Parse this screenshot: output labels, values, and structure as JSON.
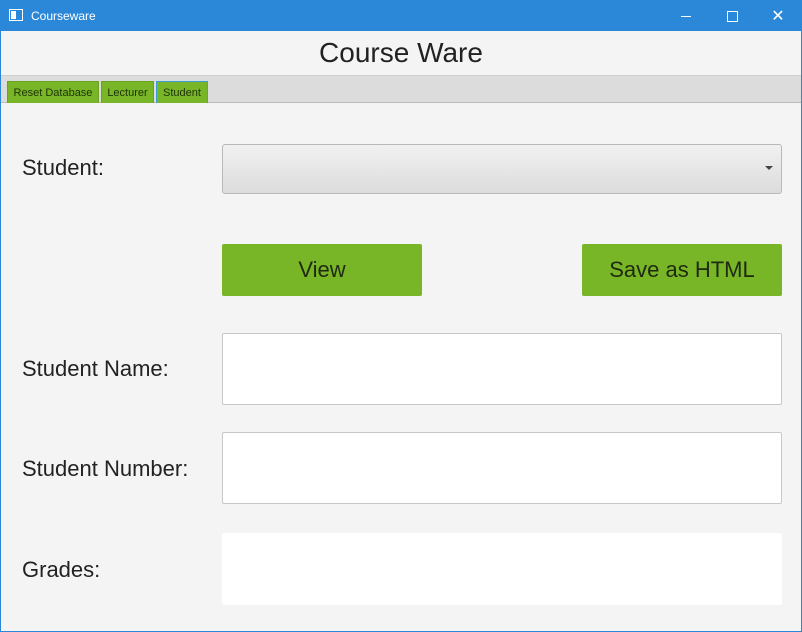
{
  "window": {
    "title": "Courseware",
    "controls": {
      "minimize": "minimize-icon",
      "maximize": "maximize-icon",
      "close": "✕"
    }
  },
  "header": {
    "title": "Course Ware"
  },
  "tabs": [
    {
      "label": "Reset Database"
    },
    {
      "label": "Lecturer"
    },
    {
      "label": "Student",
      "selected": true
    }
  ],
  "form": {
    "student_label": "Student:",
    "student_select_value": "",
    "view_button": "View",
    "save_button": "Save as HTML",
    "student_name_label": "Student Name:",
    "student_name_value": "",
    "student_number_label": "Student Number:",
    "student_number_value": "",
    "grades_label": "Grades:",
    "grades_value": ""
  },
  "colors": {
    "titlebar": "#2b88d8",
    "accent_green": "#78b628",
    "background": "#f4f4f4"
  }
}
